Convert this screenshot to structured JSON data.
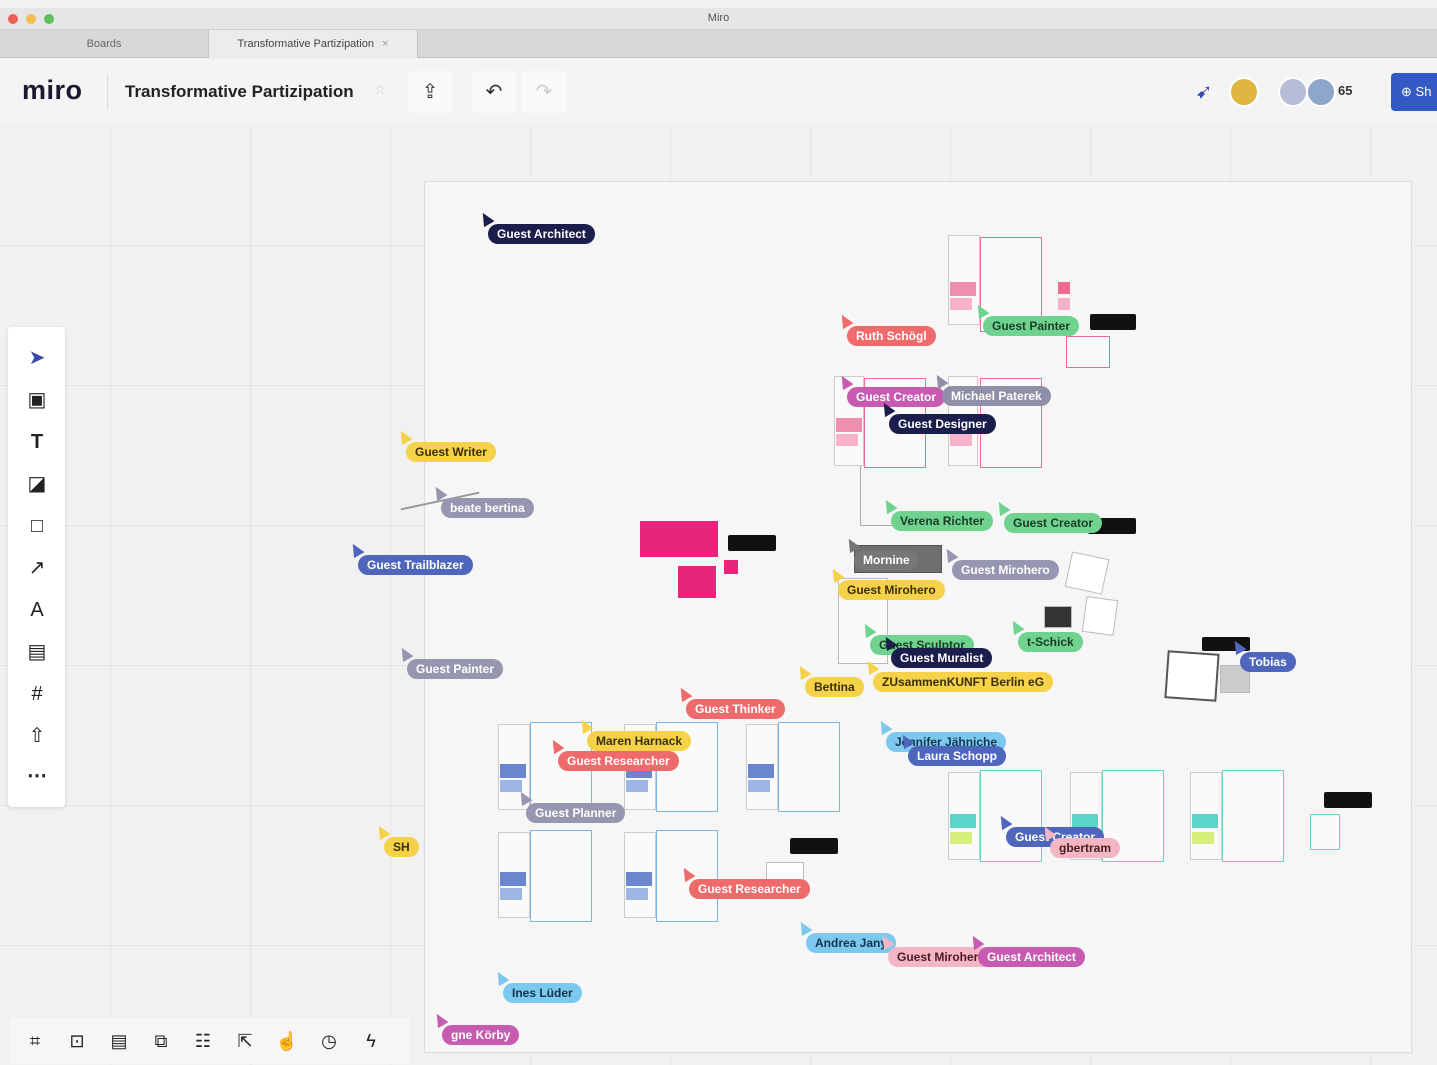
{
  "window": {
    "title": "Miro",
    "traffic_lights": [
      "#ec5f57",
      "#f5bf4f",
      "#5ac05a"
    ]
  },
  "tabs": [
    {
      "label": "Boards",
      "active": false
    },
    {
      "label": "Transformative Partizipation",
      "active": true,
      "close": "×"
    }
  ],
  "header": {
    "logo": "miro",
    "board_name": "Transformative Partizipation",
    "star_icon": "star-icon",
    "export_icon": "export-icon",
    "undo_icon": "undo-icon",
    "redo_icon": "redo-icon",
    "collab_icon": "collaborator-cursor-icon",
    "participant_count": "65",
    "share_label": "Sh"
  },
  "left_toolbar": [
    {
      "name": "select-tool",
      "icon": "cursor-arrow-icon"
    },
    {
      "name": "templates-tool",
      "icon": "template-icon"
    },
    {
      "name": "text-tool",
      "icon": "text-icon"
    },
    {
      "name": "sticky-note-tool",
      "icon": "sticky-note-icon"
    },
    {
      "name": "shape-tool",
      "icon": "square-icon"
    },
    {
      "name": "connection-line-tool",
      "icon": "arrow-line-icon"
    },
    {
      "name": "pen-tool",
      "icon": "pen-icon"
    },
    {
      "name": "comment-tool",
      "icon": "comment-icon"
    },
    {
      "name": "frame-tool",
      "icon": "frame-icon"
    },
    {
      "name": "upload-tool",
      "icon": "upload-icon"
    },
    {
      "name": "more-tools",
      "icon": "more-icon"
    }
  ],
  "bottom_toolbar": [
    {
      "name": "frames-button",
      "icon": "frames-icon"
    },
    {
      "name": "presentation-button",
      "icon": "present-icon"
    },
    {
      "name": "comments-button",
      "icon": "comments-icon"
    },
    {
      "name": "video-chat-button",
      "icon": "chat-icon"
    },
    {
      "name": "cards-button",
      "icon": "cards-icon"
    },
    {
      "name": "screenshare-button",
      "icon": "screenshare-icon"
    },
    {
      "name": "voting-button",
      "icon": "thumbs-up-icon"
    },
    {
      "name": "timer-button",
      "icon": "timer-icon"
    },
    {
      "name": "activity-button",
      "icon": "bolt-icon"
    }
  ],
  "collaborators": [
    {
      "name": "Guest Architect",
      "color": "#1b1e4b",
      "text": "#ffffff"
    },
    {
      "name": "Ruth Schögl",
      "color": "#ef6b6b",
      "text": "#ffffff"
    },
    {
      "name": "Guest Painter",
      "color": "#6fd38f",
      "text": "#1a3d25"
    },
    {
      "name": "Guest Creator",
      "color": "#c65bb1",
      "text": "#ffffff"
    },
    {
      "name": "Michael Paterek",
      "color": "#8f8fa8",
      "text": "#ffffff"
    },
    {
      "name": "Guest Designer",
      "color": "#1b1e4b",
      "text": "#ffffff"
    },
    {
      "name": "Guest Writer",
      "color": "#f6d24a",
      "text": "#3a3000"
    },
    {
      "name": "beate bertina",
      "color": "#9696b0",
      "text": "#ffffff"
    },
    {
      "name": "Verena Richter",
      "color": "#6fd38f",
      "text": "#1a3d25"
    },
    {
      "name": "Guest Creator",
      "color": "#6fd38f",
      "text": "#1a3d25"
    },
    {
      "name": "Guest Trailblazer",
      "color": "#4e67bd",
      "text": "#ffffff"
    },
    {
      "name": "Mornine",
      "color": "#777777",
      "text": "#ffffff"
    },
    {
      "name": "Guest Mirohero",
      "color": "#9696b0",
      "text": "#ffffff"
    },
    {
      "name": "Guest Mirohero",
      "color": "#f6d24a",
      "text": "#3a3000"
    },
    {
      "name": "Guest Painter",
      "color": "#9696b0",
      "text": "#ffffff"
    },
    {
      "name": "Guest Sculptor",
      "color": "#6fd38f",
      "text": "#1a3d25"
    },
    {
      "name": "Guest Muralist",
      "color": "#1b1e4b",
      "text": "#ffffff"
    },
    {
      "name": "t-Schick",
      "color": "#6fd38f",
      "text": "#1a3d25"
    },
    {
      "name": "Tobias",
      "color": "#4e67bd",
      "text": "#ffffff"
    },
    {
      "name": "Bettina",
      "color": "#f6d24a",
      "text": "#3a3000"
    },
    {
      "name": "ZUsammenKUNFT Berlin eG",
      "color": "#f6d24a",
      "text": "#3a3000"
    },
    {
      "name": "Guest Thinker",
      "color": "#ef6b6b",
      "text": "#ffffff"
    },
    {
      "name": "Maren Harnack",
      "color": "#f6d24a",
      "text": "#3a3000"
    },
    {
      "name": "Guest Researcher",
      "color": "#ef6b6b",
      "text": "#ffffff"
    },
    {
      "name": "Jennifer Jähniche",
      "color": "#7cc8ef",
      "text": "#12354a"
    },
    {
      "name": "Laura Schopp",
      "color": "#4e67bd",
      "text": "#ffffff"
    },
    {
      "name": "Guest Planner",
      "color": "#9696b0",
      "text": "#ffffff"
    },
    {
      "name": "SH",
      "color": "#f6d24a",
      "text": "#3a3000"
    },
    {
      "name": "Guest Creator",
      "color": "#4e67bd",
      "text": "#ffffff"
    },
    {
      "name": "gbertram",
      "color": "#f4b6c2",
      "text": "#4a1c26"
    },
    {
      "name": "Guest Researcher",
      "color": "#ef6b6b",
      "text": "#ffffff"
    },
    {
      "name": "Andrea Jany",
      "color": "#7cc8ef",
      "text": "#12354a"
    },
    {
      "name": "Guest Mirohero",
      "color": "#f4b6c2",
      "text": "#4a1c26"
    },
    {
      "name": "Guest Architect",
      "color": "#c65bb1",
      "text": "#ffffff"
    },
    {
      "name": "Ines Lüder",
      "color": "#7cc8ef",
      "text": "#12354a"
    },
    {
      "name": "gne Körby",
      "color": "#c65bb1",
      "text": "#ffffff"
    }
  ]
}
